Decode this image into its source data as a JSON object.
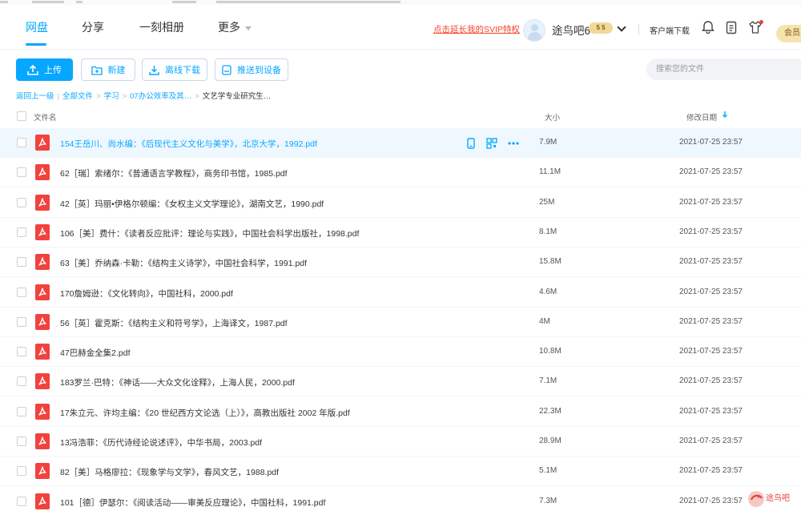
{
  "nav": {
    "items": [
      {
        "label": "网盘",
        "active": true
      },
      {
        "label": "分享",
        "active": false
      },
      {
        "label": "一刻相册",
        "active": false
      },
      {
        "label": "更多",
        "active": false
      }
    ]
  },
  "header": {
    "svip_link": "点击延长我的SVIP特权",
    "username": "途鸟吧6",
    "vip_level": "5 5",
    "client_download": "客户端下载",
    "member_button": "会员"
  },
  "toolbar": {
    "upload": "上传",
    "new": "新建",
    "offline_download": "离线下载",
    "push_to_device": "推送到设备",
    "search_placeholder": "搜索您的文件"
  },
  "breadcrumb": {
    "back": "返回上一级",
    "all_files": "全部文件",
    "study": "学习",
    "folder1": "07办公效率及其…",
    "current": "文艺学专业研究生…"
  },
  "table": {
    "col_name": "文件名",
    "col_size": "大小",
    "col_date": "修改日期"
  },
  "files": [
    {
      "name": "154王岳川、尚水编：《后现代主义文化与美学》，北京大学，1992.pdf",
      "size": "7.9M",
      "date": "2021-07-25 23:57"
    },
    {
      "name": "62［瑞］索绪尔：《普通语言学教程》，商务印书馆，1985.pdf",
      "size": "11.1M",
      "date": "2021-07-25 23:57"
    },
    {
      "name": "42［英］玛丽•伊格尔顿编：《女权主义文学理论》，湖南文艺，1990.pdf",
      "size": "25M",
      "date": "2021-07-25 23:57"
    },
    {
      "name": "106［美］费什：《读者反应批评：理论与实践》，中国社会科学出版社，1998.pdf",
      "size": "8.1M",
      "date": "2021-07-25 23:57"
    },
    {
      "name": "63［美］乔纳森·卡勒：《结构主义诗学》，中国社会科学，1991.pdf",
      "size": "15.8M",
      "date": "2021-07-25 23:57"
    },
    {
      "name": "170詹姆逊：《文化转向》，中国社科，2000.pdf",
      "size": "4.6M",
      "date": "2021-07-25 23:57"
    },
    {
      "name": "56［英］霍克斯：《结构主义和符号学》，上海译文，1987.pdf",
      "size": "4M",
      "date": "2021-07-25 23:57"
    },
    {
      "name": "47巴赫金全集2.pdf",
      "size": "10.8M",
      "date": "2021-07-25 23:57"
    },
    {
      "name": "183罗兰·巴特：《神话——大众文化诠释》，上海人民，2000.pdf",
      "size": "7.1M",
      "date": "2021-07-25 23:57"
    },
    {
      "name": "17朱立元、许均主编：《20 世纪西方文论选（上）》，高教出版社 2002 年版.pdf",
      "size": "22.3M",
      "date": "2021-07-25 23:57"
    },
    {
      "name": "13冯浩菲：《历代诗经论说述评》，中华书局，2003.pdf",
      "size": "28.9M",
      "date": "2021-07-25 23:57"
    },
    {
      "name": "82［美］马格廖拉：《现象学与文学》，春风文艺，1988.pdf",
      "size": "5.1M",
      "date": "2021-07-25 23:57"
    },
    {
      "name": "101［德］伊瑟尔：《阅读活动——审美反应理论》，中国社科，1991.pdf",
      "size": "7.3M",
      "date": "2021-07-25 23:57"
    }
  ],
  "colors": {
    "accent": "#06a7ff",
    "pdf_red": "#f2423d",
    "svip_red": "#f5422b"
  }
}
